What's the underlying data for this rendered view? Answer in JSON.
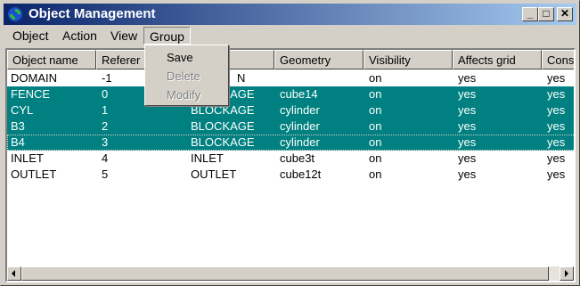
{
  "window": {
    "title": "Object Management",
    "min_label": "_",
    "max_label": "□",
    "close_label": "✕"
  },
  "menu": [
    {
      "label": "Object"
    },
    {
      "label": "Action"
    },
    {
      "label": "View"
    },
    {
      "label": "Group"
    }
  ],
  "group_menu": [
    {
      "label": "Save",
      "enabled": true
    },
    {
      "label": "Delete",
      "enabled": false
    },
    {
      "label": "Modify",
      "enabled": false
    }
  ],
  "columns": [
    "Object name",
    "Referer",
    "",
    "Geometry",
    "Visibility",
    "Affects grid",
    "Const"
  ],
  "rows": [
    {
      "name": "DOMAIN",
      "ref": "-1",
      "type": "N",
      "geometry": "",
      "visibility": "on",
      "affects_grid": "yes",
      "const": "yes",
      "selected": false
    },
    {
      "name": "FENCE",
      "ref": "0",
      "type": "BLOCKAGE",
      "geometry": "cube14",
      "visibility": "on",
      "affects_grid": "yes",
      "const": "yes",
      "selected": true
    },
    {
      "name": "CYL",
      "ref": "1",
      "type": "BLOCKAGE",
      "geometry": "cylinder",
      "visibility": "on",
      "affects_grid": "yes",
      "const": "yes",
      "selected": true
    },
    {
      "name": "B3",
      "ref": "2",
      "type": "BLOCKAGE",
      "geometry": "cylinder",
      "visibility": "on",
      "affects_grid": "yes",
      "const": "yes",
      "selected": true
    },
    {
      "name": "B4",
      "ref": "3",
      "type": "BLOCKAGE",
      "geometry": "cylinder",
      "visibility": "on",
      "affects_grid": "yes",
      "const": "yes",
      "selected": true
    },
    {
      "name": "INLET",
      "ref": "4",
      "type": "INLET",
      "geometry": "cube3t",
      "visibility": "on",
      "affects_grid": "yes",
      "const": "yes",
      "selected": false
    },
    {
      "name": "OUTLET",
      "ref": "5",
      "type": "OUTLET",
      "geometry": "cube12t",
      "visibility": "on",
      "affects_grid": "yes",
      "const": "yes",
      "selected": false
    }
  ],
  "colors": {
    "selection": "#008080",
    "title_start": "#0a246a",
    "title_end": "#a6caf0"
  }
}
